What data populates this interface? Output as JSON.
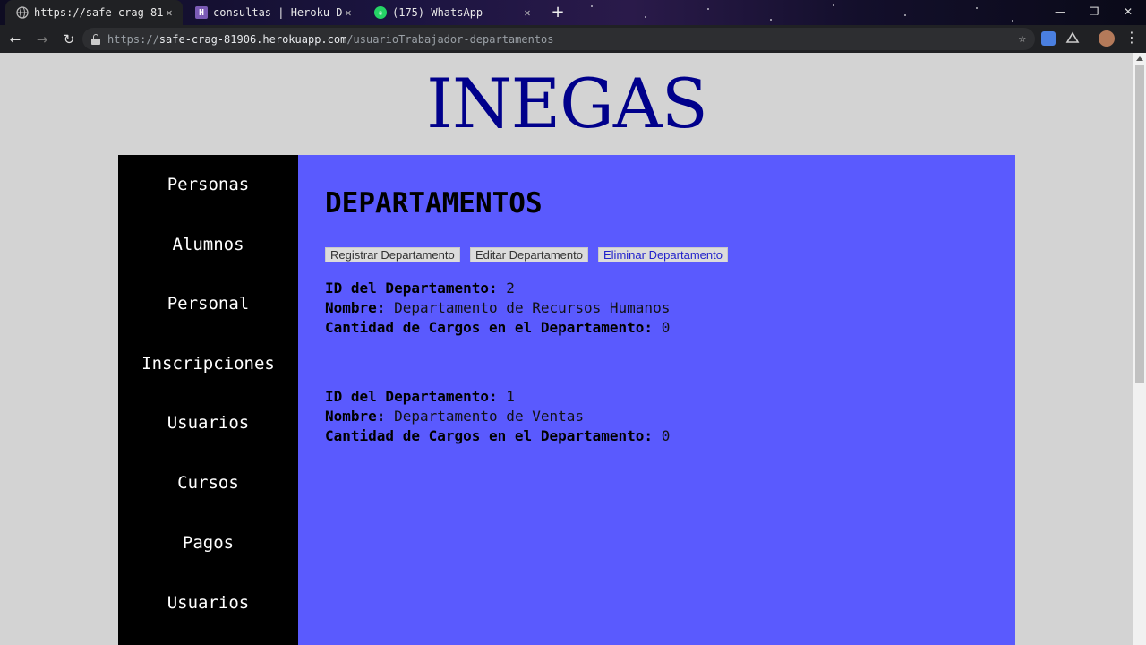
{
  "browser": {
    "tabs": [
      {
        "title": "https://safe-crag-81906",
        "favicon": "globe-icon",
        "active": true
      },
      {
        "title": "consultas | Heroku Da",
        "favicon": "heroku-icon",
        "active": false
      },
      {
        "title": "(175) WhatsApp",
        "favicon": "whatsapp-icon",
        "active": false
      }
    ],
    "new_tab": "+",
    "url_scheme": "https://",
    "url_host": "safe-crag-81906.herokuapp.com",
    "url_path": "/usuarioTrabajador-departamentos"
  },
  "site": {
    "logo": "INEGAS",
    "colors": {
      "logo": "#00008b",
      "sidebar": "#000000",
      "content": "#5a5afe",
      "background": "#d3d3d3"
    }
  },
  "sidebar": {
    "items": [
      {
        "label": "Personas"
      },
      {
        "label": "Alumnos"
      },
      {
        "label": "Personal"
      },
      {
        "label": "Inscripciones"
      },
      {
        "label": "Usuarios"
      },
      {
        "label": "Cursos"
      },
      {
        "label": "Pagos"
      },
      {
        "label": "Usuarios"
      }
    ]
  },
  "main": {
    "title": "DEPARTAMENTOS",
    "buttons": {
      "register": "Registrar Departamento",
      "edit": "Editar Departamento",
      "delete": "Eliminar Departamento"
    },
    "labels": {
      "id": "ID del Departamento:",
      "name": "Nombre:",
      "count": "Cantidad de Cargos en el Departamento:"
    },
    "records": [
      {
        "id": "2",
        "name": "Departamento de Recursos Humanos",
        "count": "0"
      },
      {
        "id": "1",
        "name": "Departamento de Ventas",
        "count": "0"
      }
    ]
  }
}
